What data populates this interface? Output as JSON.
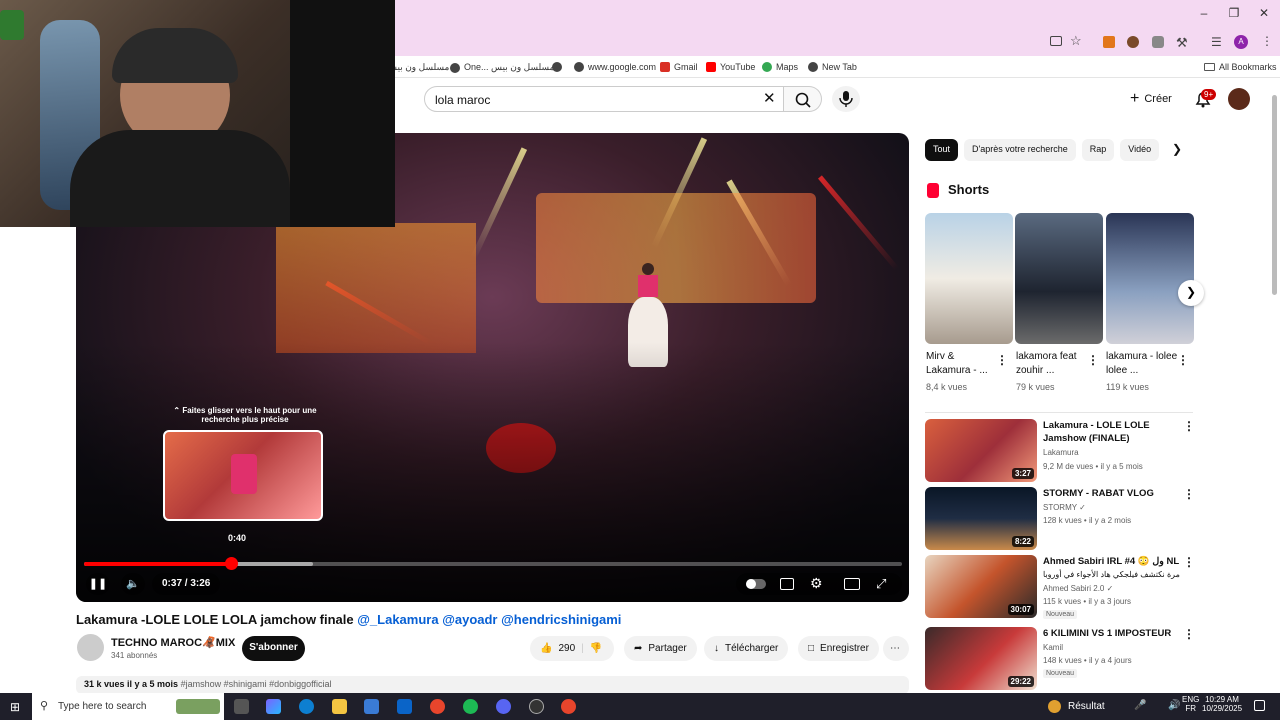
{
  "browser": {
    "bookmarks": [
      {
        "label": "مسلسل ون بيس"
      },
      {
        "label": "One... مسلسل ون بيس"
      },
      {
        "label": "www.google.com"
      },
      {
        "label": "Gmail"
      },
      {
        "label": "YouTube"
      },
      {
        "label": "Maps"
      },
      {
        "label": "New Tab"
      }
    ],
    "all_bookmarks": "All Bookmarks",
    "profile_initial": "A"
  },
  "youtube": {
    "search_value": "lola maroc",
    "create_label": "Créer",
    "notif_count": "9+"
  },
  "player": {
    "preview_hint": "Faites glisser vers le haut pour une recherche plus précise",
    "preview_time": "0:40",
    "current_time": "0:37 / 3:26",
    "progress_played": 0.18,
    "progress_buffered": 0.28
  },
  "video": {
    "title_main": "Lakamura -LOLE LOLE LOLA jamchow finale",
    "title_tags": "@_Lakamura @ayoadr @hendricshinigami",
    "channel": "TECHNO MAROC🦧MIX",
    "subs": "341 abonnés",
    "subscribe": "S'abonner",
    "likes": "290",
    "share": "Partager",
    "download": "Télécharger",
    "save": "Enregistrer",
    "desc_stats": "31 k vues  il y a 5 mois",
    "desc_tags": "#jamshow #shinigami #donbiggofficial"
  },
  "sidebar": {
    "chips": [
      "Tout",
      "D'après votre recherche",
      "Rap",
      "Vidéo"
    ],
    "shorts_title": "Shorts",
    "shorts": [
      {
        "title": "Mirv & Lakamura - ...",
        "views": "8,4 k vues"
      },
      {
        "title": "lakamora feat zouhir ...",
        "views": "79 k vues"
      },
      {
        "title": "lakamura - lolee lolee ...",
        "views": "119 k vues"
      }
    ],
    "recs": [
      {
        "title": "Lakamura - LOLE LOLE",
        "title2": "Jamshow (FINALE)",
        "channel": "Lakamura",
        "meta": "9,2 M de vues • il y a 5 mois",
        "duration": "3:27",
        "badge": ""
      },
      {
        "title": "STORMY - RABAT VLOG",
        "title2": "",
        "channel": "STORMY ✓",
        "meta": "128 k vues • il y a 2 mois",
        "duration": "8:22",
        "badge": ""
      },
      {
        "title": "Ahmed Sabiri IRL #4 😳 ول NL",
        "title2": "مرة نكتشف فيلجكي هاد الأجواء في أوروبا ...",
        "channel": "Ahmed Sabiri 2.0 ✓",
        "meta": "115 k vues • il y a 3 jours",
        "duration": "30:07",
        "badge": "Nouveau"
      },
      {
        "title": "6 KILIMINI VS 1 IMPOSTEUR",
        "title2": "",
        "channel": "Kamil",
        "meta": "148 k vues • il y a 4 jours",
        "duration": "29:22",
        "badge": "Nouveau"
      }
    ]
  },
  "taskbar": {
    "search_placeholder": "Type here to search",
    "weather": "Résultat",
    "lang": "ENG",
    "lang2": "FR",
    "time": "10:29 AM",
    "date": "10/29/2025"
  }
}
